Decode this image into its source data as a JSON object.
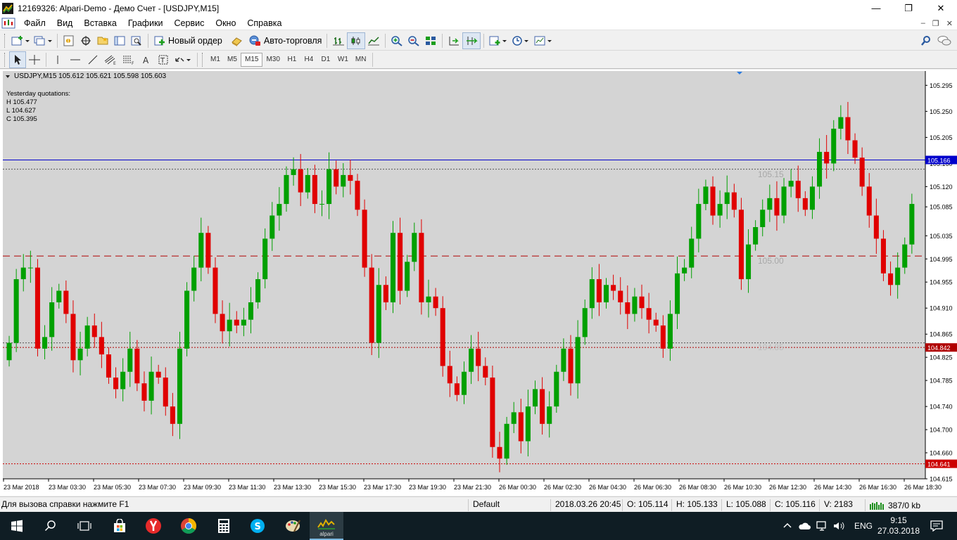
{
  "window": {
    "title": "12169326: Alpari-Demo - Демо Счет - [USDJPY,M15]"
  },
  "window_controls": {
    "minimize": "—",
    "maximize": "❐",
    "close": "✕"
  },
  "mdi_controls": {
    "minimize": "–",
    "restore": "❐",
    "close": "✕"
  },
  "menu": [
    "Файл",
    "Вид",
    "Вставка",
    "Графики",
    "Сервис",
    "Окно",
    "Справка"
  ],
  "toolbar": {
    "new_order": "Новый ордер",
    "auto_trading": "Авто-торговля"
  },
  "timeframes": [
    "M1",
    "M5",
    "M15",
    "M30",
    "H1",
    "H4",
    "D1",
    "W1",
    "MN"
  ],
  "active_timeframe": "M15",
  "chart": {
    "header": "USDJPY,M15  105.612 105.621 105.598 105.603",
    "info": {
      "title": "Yesterday quotations:",
      "high": "H 105.477",
      "low": "L 104.627",
      "close": "C 105.395"
    },
    "ghost_labels": [
      "105.15",
      "105.00",
      "104.85"
    ]
  },
  "chart_data": {
    "type": "candlestick",
    "symbol": "USDJPY",
    "timeframe": "M15",
    "y_ticks": [
      "105.295",
      "105.250",
      "105.205",
      "105.160",
      "105.120",
      "105.085",
      "105.035",
      "104.995",
      "104.955",
      "104.910",
      "104.865",
      "104.825",
      "104.785",
      "104.740",
      "104.700",
      "104.660",
      "104.615"
    ],
    "ylim": [
      104.615,
      105.31
    ],
    "x_ticks": [
      "23 Mar 2018",
      "23 Mar 03:30",
      "23 Mar 05:30",
      "23 Mar 07:30",
      "23 Mar 09:30",
      "23 Mar 11:30",
      "23 Mar 13:30",
      "23 Mar 15:30",
      "23 Mar 17:30",
      "23 Mar 19:30",
      "23 Mar 21:30",
      "26 Mar 00:30",
      "26 Mar 02:30",
      "26 Mar 04:30",
      "26 Mar 06:30",
      "26 Mar 08:30",
      "26 Mar 10:30",
      "26 Mar 12:30",
      "26 Mar 14:30",
      "26 Mar 16:30",
      "26 Mar 18:30"
    ],
    "levels": [
      {
        "price": 105.166,
        "label": "105.166",
        "style": "solid",
        "color": "#0000cc"
      },
      {
        "price": 105.15,
        "label": "",
        "style": "dotted",
        "color": "#555555"
      },
      {
        "price": 105.0,
        "label": "",
        "style": "dashed",
        "color": "#b00000"
      },
      {
        "price": 104.85,
        "label": "",
        "style": "dotted",
        "color": "#555555"
      },
      {
        "price": 104.842,
        "label": "104.842",
        "style": "dotted",
        "color": "#b00000"
      },
      {
        "price": 104.641,
        "label": "104.641",
        "style": "dotted",
        "color": "#cc0000"
      }
    ],
    "closes": [
      104.85,
      104.96,
      104.98,
      104.98,
      104.84,
      104.86,
      104.92,
      104.94,
      104.9,
      104.82,
      104.84,
      104.88,
      104.86,
      104.83,
      104.79,
      104.77,
      104.8,
      104.84,
      104.78,
      104.75,
      104.8,
      104.79,
      104.74,
      104.71,
      104.84,
      104.94,
      104.98,
      105.04,
      104.98,
      104.9,
      104.87,
      104.89,
      104.88,
      104.89,
      104.92,
      104.96,
      105.03,
      105.07,
      105.09,
      105.14,
      105.15,
      105.11,
      105.14,
      105.09,
      105.09,
      105.15,
      105.12,
      105.14,
      105.13,
      105.08,
      104.98,
      104.85,
      104.95,
      104.92,
      105.04,
      104.94,
      104.99,
      105.04,
      104.92,
      104.93,
      104.91,
      104.81,
      104.78,
      104.76,
      104.8,
      104.84,
      104.81,
      104.79,
      104.67,
      104.65,
      104.71,
      104.73,
      104.68,
      104.74,
      104.77,
      104.71,
      104.74,
      104.8,
      104.84,
      104.78,
      104.86,
      104.91,
      104.96,
      104.92,
      104.95,
      104.94,
      104.92,
      104.9,
      104.93,
      104.91,
      104.89,
      104.88,
      104.84,
      104.9,
      104.97,
      104.98,
      105.03,
      105.09,
      105.12,
      105.07,
      105.09,
      105.11,
      105.08,
      104.96,
      105.02,
      105.05,
      105.08,
      105.1,
      105.07,
      105.12,
      105.13,
      105.1,
      105.08,
      105.12,
      105.18,
      105.16,
      105.22,
      105.24,
      105.2,
      105.17,
      105.12,
      105.07,
      105.03,
      104.97,
      104.95,
      104.98,
      105.02,
      105.09
    ]
  },
  "status": {
    "help": "Для вызова справки нажмите F1",
    "profile": "Default",
    "datetime": "2018.03.26 20:45",
    "open": "O: 105.114",
    "high": "H: 105.133",
    "low": "L: 105.088",
    "close": "C: 105.116",
    "volume": "V: 2183",
    "traffic": "387/0 kb"
  },
  "taskbar": {
    "lang": "ENG",
    "time": "9:15",
    "date": "27.03.2018",
    "alpari_label": "alpari"
  },
  "colors": {
    "bull": "#00a000",
    "bear": "#e00000",
    "chart_bg": "#d4d4d4",
    "accent": "#0000cc"
  }
}
